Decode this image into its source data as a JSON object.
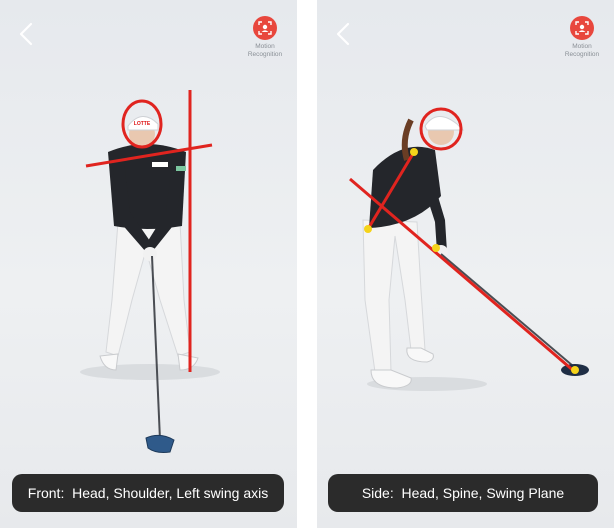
{
  "panels": [
    {
      "view": "front",
      "caption": "Front:  Head, Shoulder, Left swing axis",
      "motion_button_label": "Motion\nRecognition",
      "cap_logo": "LOTTE",
      "overlays": [
        "head-circle",
        "shoulder-line",
        "left-swing-axis-line"
      ]
    },
    {
      "view": "side",
      "caption": "Side:  Head, Spine, Swing Plane",
      "motion_button_label": "Motion\nRecognition",
      "overlays": [
        "head-circle",
        "spine-line",
        "swing-plane-line"
      ]
    }
  ],
  "colors": {
    "overlay_red": "#e0241f",
    "marker_yellow": "#f5d31a",
    "motion_button": "#e8473d",
    "caption_bg": "#2b2b2b",
    "caption_text": "#ffffff"
  },
  "icons": [
    "back-chevron-icon",
    "camera-scan-icon"
  ]
}
